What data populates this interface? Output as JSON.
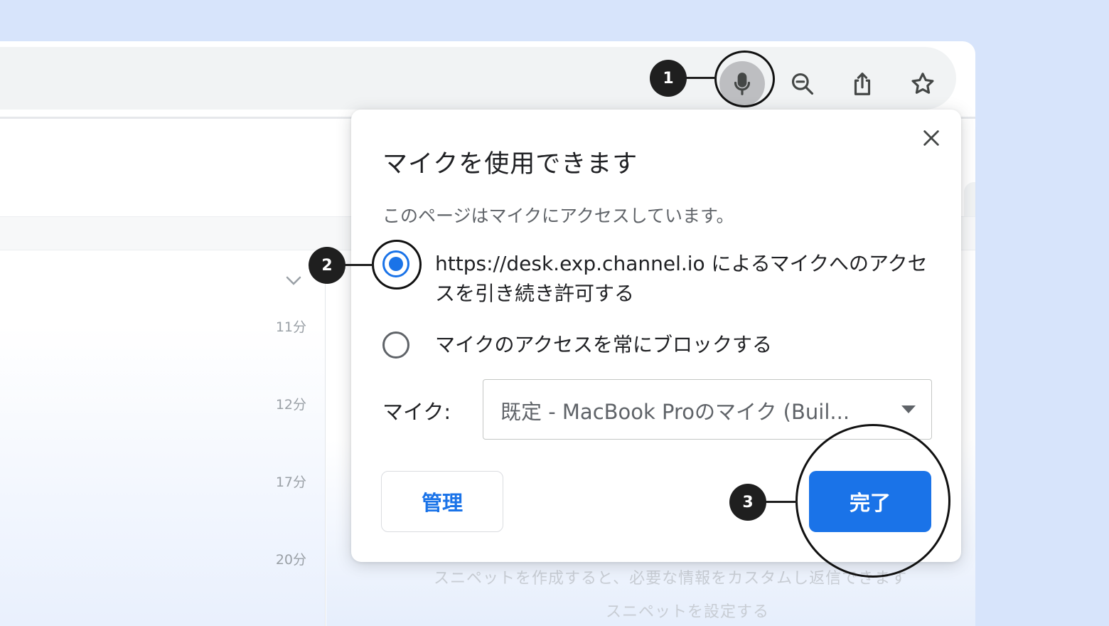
{
  "toolbar": {
    "mic_icon": "microphone-icon",
    "zoom_icon": "zoom-out-icon",
    "share_icon": "share-icon",
    "bookmark_icon": "star-icon"
  },
  "background": {
    "times": [
      "11分",
      "12分",
      "17分",
      "20分"
    ],
    "snippet_hint": "スニペットを作成すると、必要な情報をカスタムし返信できます",
    "snippet_link": "スニペットを設定する"
  },
  "dialog": {
    "title": "マイクを使用できます",
    "subtitle": "このページはマイクにアクセスしています。",
    "option_allow": "https://desk.exp.channel.io によるマイクへのアクセスを引き続き許可する",
    "option_block": "マイクのアクセスを常にブロックする",
    "mic_label": "マイク:",
    "mic_select_value": "既定 - MacBook Proのマイク (Buil...",
    "manage_label": "管理",
    "done_label": "完了",
    "selected_option": "allow"
  },
  "annotations": {
    "badge1": "1",
    "badge2": "2",
    "badge3": "3"
  },
  "colors": {
    "accent": "#1a73e8",
    "page_bg": "#d7e4fb",
    "badge": "#1f1f1f"
  }
}
